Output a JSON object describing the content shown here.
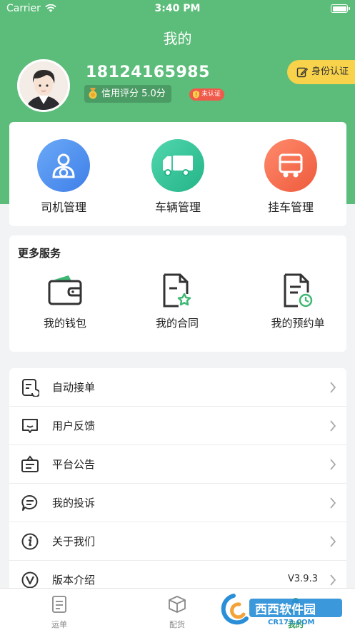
{
  "status_bar": {
    "carrier": "Carrier",
    "time": "3:40 PM"
  },
  "header": {
    "title": "我的",
    "phone": "18124165985",
    "credit_label": "信用评分 5.0分",
    "unverified_badge": "未认证",
    "id_verify_button": "身份认证"
  },
  "management": {
    "items": [
      {
        "label": "司机管理",
        "icon": "driver-icon",
        "color": "#4a8df2"
      },
      {
        "label": "车辆管理",
        "icon": "truck-icon",
        "color": "#2fc39a"
      },
      {
        "label": "挂车管理",
        "icon": "trailer-icon",
        "color": "#f26a4f"
      }
    ]
  },
  "services": {
    "title": "更多服务",
    "items": [
      {
        "label": "我的钱包",
        "icon": "wallet-icon"
      },
      {
        "label": "我的合同",
        "icon": "contract-icon"
      },
      {
        "label": "我的预约单",
        "icon": "reservation-icon"
      }
    ]
  },
  "menu": {
    "items": [
      {
        "label": "自动接单",
        "icon": "auto-order-icon"
      },
      {
        "label": "用户反馈",
        "icon": "feedback-icon"
      },
      {
        "label": "平台公告",
        "icon": "announcement-icon"
      },
      {
        "label": "我的投诉",
        "icon": "complaint-icon"
      },
      {
        "label": "关于我们",
        "icon": "info-icon"
      },
      {
        "label": "版本介绍",
        "icon": "version-icon",
        "value": "V3.9.3"
      }
    ]
  },
  "tabbar": {
    "items": [
      {
        "label": "运单",
        "icon": "waybill-icon"
      },
      {
        "label": "配货",
        "icon": "cargo-box-icon"
      },
      {
        "label": "我的",
        "icon": "profile-icon",
        "active": true
      }
    ]
  },
  "watermark": {
    "text": "西西软件园",
    "sub": "CR173.COM"
  },
  "colors": {
    "brand_green": "#5cbd7a",
    "badge_yellow": "#f7d24a",
    "badge_red": "#f05a4a"
  }
}
